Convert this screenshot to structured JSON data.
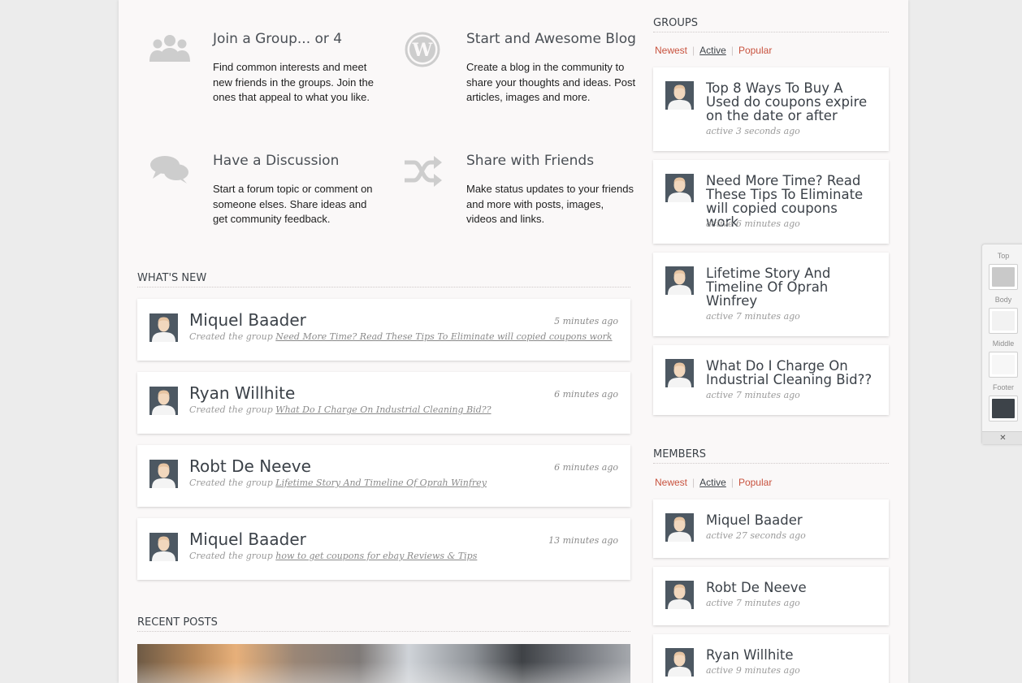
{
  "features": [
    {
      "title": "Join a Group... or 4",
      "text": "Find common interests and meet new friends in the groups. Join the ones that appeal to what you like.",
      "icon": "group-icon"
    },
    {
      "title": "Start and Awesome Blog",
      "text": "Create a blog in the community to share your thoughts and ideas. Post articles, images and more.",
      "icon": "wordpress-icon"
    },
    {
      "title": "Have a Discussion",
      "text": "Start a forum topic or comment on someone elses. Share ideas and get community feedback.",
      "icon": "speech-bubbles-icon"
    },
    {
      "title": "Share with Friends",
      "text": "Make status updates to your friends and more with posts, images, videos and links.",
      "icon": "shuffle-icon"
    }
  ],
  "whats_new": {
    "title": "WHAT'S NEW",
    "items": [
      {
        "name": "Miquel Baader",
        "time": "5 minutes ago",
        "prefix": "Created the group",
        "link": "Need More Time? Read These Tips To Eliminate will copied coupons work"
      },
      {
        "name": "Ryan Willhite",
        "time": "6 minutes ago",
        "prefix": "Created the group",
        "link": "What Do I Charge On Industrial Cleaning Bid??"
      },
      {
        "name": "Robt De Neeve",
        "time": "6 minutes ago",
        "prefix": "Created the group",
        "link": "Lifetime Story And Timeline Of Oprah Winfrey"
      },
      {
        "name": "Miquel Baader",
        "time": "13 minutes ago",
        "prefix": "Created the group",
        "link": "how to get coupons for ebay Reviews & Tips"
      }
    ]
  },
  "recent_posts": {
    "title": "RECENT POSTS"
  },
  "groups": {
    "title": "GROUPS",
    "tabs": [
      "Newest",
      "Active",
      "Popular"
    ],
    "active_tab": "Active",
    "items": [
      {
        "title": "Top 8 Ways To Buy A Used do coupons expire on the date or after",
        "active": "active 3 seconds ago"
      },
      {
        "title": "Need More Time? Read These Tips To Eliminate will copied coupons work",
        "active": "active 6 minutes ago"
      },
      {
        "title": "Lifetime Story And Timeline Of Oprah Winfrey",
        "active": "active 7 minutes ago"
      },
      {
        "title": "What Do I Charge On Industrial Cleaning Bid??",
        "active": "active 7 minutes ago"
      }
    ]
  },
  "members": {
    "title": "MEMBERS",
    "tabs": [
      "Newest",
      "Active",
      "Popular"
    ],
    "active_tab": "Active",
    "items": [
      {
        "name": "Miquel Baader",
        "active": "active 27 seconds ago"
      },
      {
        "name": "Robt De Neeve",
        "active": "active 7 minutes ago"
      },
      {
        "name": "Ryan Willhite",
        "active": "active 9 minutes ago"
      }
    ]
  },
  "style_switcher": {
    "labels": [
      "Top",
      "Body",
      "Middle",
      "Footer"
    ],
    "colors": [
      "#c9c9c9",
      "#f2f2f2",
      "#f7f7f7",
      "#3d4349"
    ],
    "close": "✕"
  },
  "colors": {
    "accent": "#c8523e",
    "text": "#3d4349",
    "page_bg": "#faf8f8"
  }
}
